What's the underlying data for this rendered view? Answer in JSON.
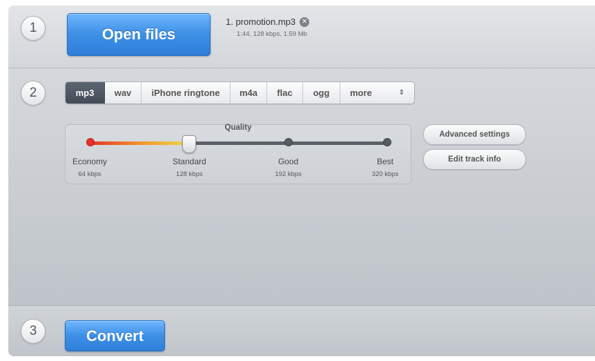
{
  "step1": {
    "number": "1",
    "open_files_label": "Open files",
    "file": {
      "name": "1. promotion.mp3",
      "meta": "1:44, 128 kbps, 1.59 Mb",
      "remove_icon": "close-circle-icon"
    }
  },
  "step2": {
    "number": "2",
    "formats": [
      {
        "label": "mp3",
        "active": true
      },
      {
        "label": "wav",
        "active": false
      },
      {
        "label": "iPhone ringtone",
        "active": false
      },
      {
        "label": "m4a",
        "active": false
      },
      {
        "label": "flac",
        "active": false
      },
      {
        "label": "ogg",
        "active": false
      },
      {
        "label": "more",
        "active": false
      }
    ],
    "quality": {
      "title": "Quality",
      "selected_index": 1,
      "stops": [
        {
          "label": "Economy",
          "bitrate": "64 kbps"
        },
        {
          "label": "Standard",
          "bitrate": "128 kbps"
        },
        {
          "label": "Good",
          "bitrate": "192 kbps"
        },
        {
          "label": "Best",
          "bitrate": "320 kbps"
        }
      ]
    },
    "advanced_settings_label": "Advanced settings",
    "edit_track_info_label": "Edit track info"
  },
  "step3": {
    "number": "3",
    "convert_label": "Convert"
  },
  "colors": {
    "accent_blue": "#3c8fe6",
    "active_tab": "#4d5560",
    "slider_red": "#e43227",
    "slider_yellow": "#e8d94a"
  }
}
